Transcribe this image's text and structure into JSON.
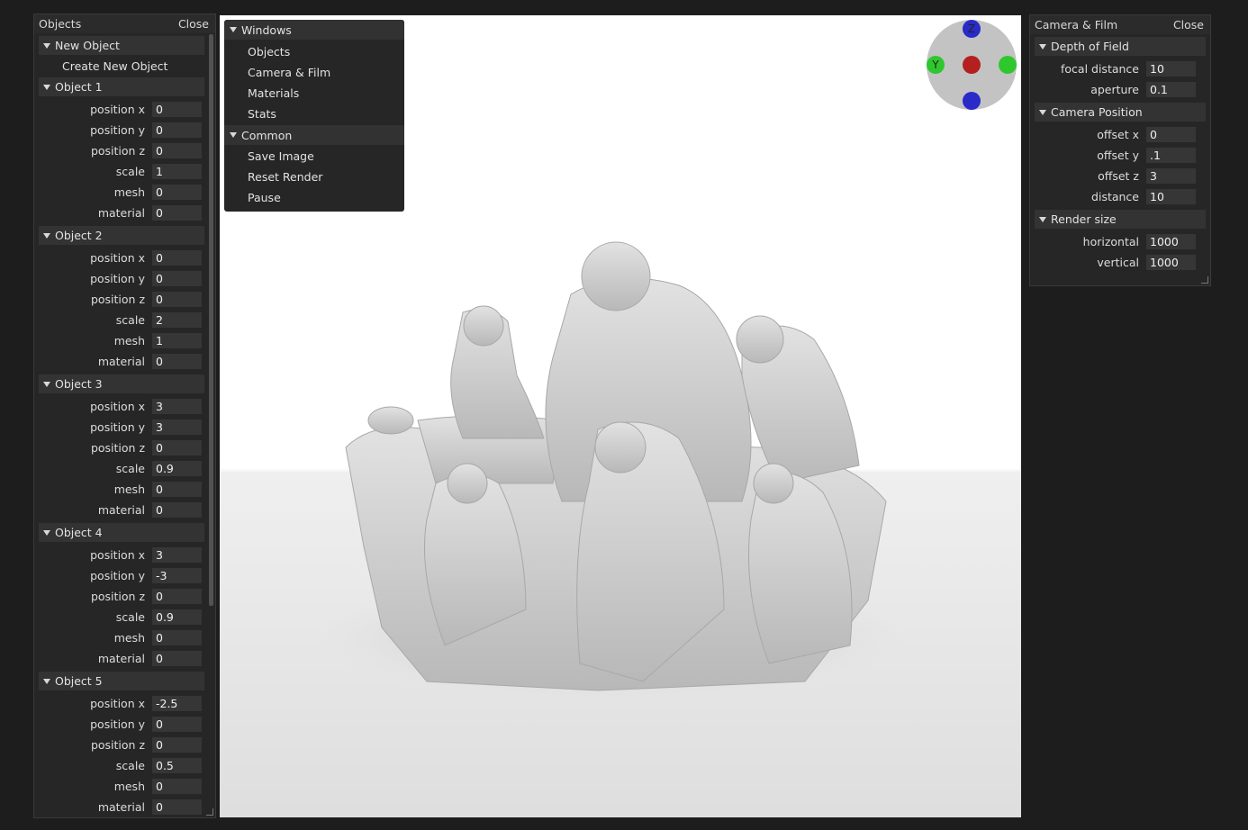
{
  "objects_panel": {
    "title": "Objects",
    "close_label": "Close",
    "new_object_header": "New Object",
    "create_button": "Create New Object",
    "objects": [
      {
        "header": "Object 1",
        "props": [
          {
            "label": "position x",
            "value": "0"
          },
          {
            "label": "position y",
            "value": "0"
          },
          {
            "label": "position z",
            "value": "0"
          },
          {
            "label": "scale",
            "value": "1"
          },
          {
            "label": "mesh",
            "value": "0"
          },
          {
            "label": "material",
            "value": "0"
          }
        ]
      },
      {
        "header": "Object 2",
        "props": [
          {
            "label": "position x",
            "value": "0"
          },
          {
            "label": "position y",
            "value": "0"
          },
          {
            "label": "position z",
            "value": "0"
          },
          {
            "label": "scale",
            "value": "2"
          },
          {
            "label": "mesh",
            "value": "1"
          },
          {
            "label": "material",
            "value": "0"
          }
        ]
      },
      {
        "header": "Object 3",
        "props": [
          {
            "label": "position x",
            "value": "3"
          },
          {
            "label": "position y",
            "value": "3"
          },
          {
            "label": "position z",
            "value": "0"
          },
          {
            "label": "scale",
            "value": "0.9"
          },
          {
            "label": "mesh",
            "value": "0"
          },
          {
            "label": "material",
            "value": "0"
          }
        ]
      },
      {
        "header": "Object 4",
        "props": [
          {
            "label": "position x",
            "value": "3"
          },
          {
            "label": "position y",
            "value": "-3"
          },
          {
            "label": "position z",
            "value": "0"
          },
          {
            "label": "scale",
            "value": "0.9"
          },
          {
            "label": "mesh",
            "value": "0"
          },
          {
            "label": "material",
            "value": "0"
          }
        ]
      },
      {
        "header": "Object 5",
        "props": [
          {
            "label": "position x",
            "value": "-2.5"
          },
          {
            "label": "position y",
            "value": "0"
          },
          {
            "label": "position z",
            "value": "0"
          },
          {
            "label": "scale",
            "value": "0.5"
          },
          {
            "label": "mesh",
            "value": "0"
          },
          {
            "label": "material",
            "value": "0"
          }
        ]
      }
    ]
  },
  "windows_menu": {
    "header": "Windows",
    "items": [
      "Objects",
      "Camera & Film",
      "Materials",
      "Stats"
    ],
    "common_header": "Common",
    "common_items": [
      "Save Image",
      "Reset Render",
      "Pause"
    ]
  },
  "camera_panel": {
    "title": "Camera & Film",
    "close_label": "Close",
    "dof_header": "Depth of Field",
    "dof": [
      {
        "label": "focal distance",
        "value": "10"
      },
      {
        "label": "aperture",
        "value": "0.1"
      }
    ],
    "position_header": "Camera Position",
    "position": [
      {
        "label": "offset x",
        "value": "0"
      },
      {
        "label": "offset y",
        "value": ".1"
      },
      {
        "label": "offset z",
        "value": "3"
      },
      {
        "label": "distance",
        "value": "10"
      }
    ],
    "render_header": "Render size",
    "render": [
      {
        "label": "horizontal",
        "value": "1000"
      },
      {
        "label": "vertical",
        "value": "1000"
      }
    ]
  },
  "gizmo": {
    "z_label": "Z",
    "y_label": "Y",
    "colors": {
      "z": "#2a2ac8",
      "y": "#2ec82e",
      "x": "#b42020",
      "ring": "#c3c3c3"
    }
  }
}
